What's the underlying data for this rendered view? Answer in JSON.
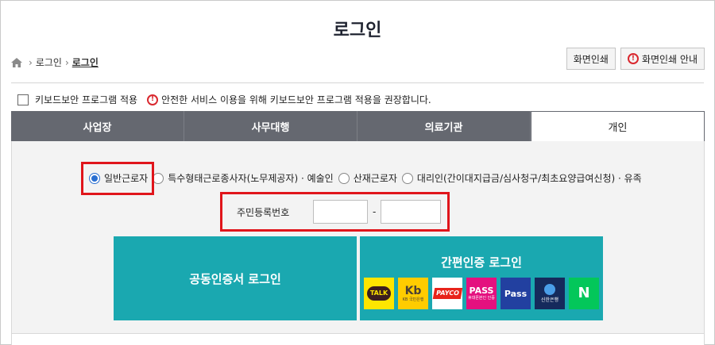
{
  "page_title": "로그인",
  "breadcrumb": {
    "items": [
      "로그인",
      "로그인"
    ]
  },
  "buttons": {
    "print": "화면인쇄",
    "print_guide": "화면인쇄 안내"
  },
  "keyboard_security": {
    "label": "키보드보안 프로그램 적용",
    "notice": "안전한 서비스 이용을 위해 키보드보안 프로그램 적용을 권장합니다."
  },
  "tabs": [
    {
      "label": "사업장",
      "active": false
    },
    {
      "label": "사무대행",
      "active": false
    },
    {
      "label": "의료기관",
      "active": false
    },
    {
      "label": "개인",
      "active": true
    }
  ],
  "user_types": [
    {
      "label": "일반근로자",
      "checked": true
    },
    {
      "label": "특수형태근로종사자(노무제공자) · 예술인",
      "checked": false
    },
    {
      "label": "산재근로자",
      "checked": false
    },
    {
      "label": "대리인(간이대지급금/심사청구/최초요양급여신청) · 유족",
      "checked": false
    }
  ],
  "rrn": {
    "label": "주민등록번호",
    "separator": "-"
  },
  "login_options": {
    "certificate": "공동인증서 로그인",
    "simple": "간편인증 로그인"
  },
  "simple_auth_logos": [
    {
      "name": "kakao",
      "text": "TALK",
      "sub": ""
    },
    {
      "name": "kb",
      "text": "Kb",
      "sub": "KB 국민은행"
    },
    {
      "name": "payco",
      "text": "PAYCO",
      "sub": ""
    },
    {
      "name": "pass1",
      "text": "PASS",
      "sub": "휴대폰본인 인증"
    },
    {
      "name": "pass2",
      "text": "Pass",
      "sub": ""
    },
    {
      "name": "shinhan",
      "text": "",
      "sub": "신한은행"
    },
    {
      "name": "naver",
      "text": "N",
      "sub": ""
    }
  ],
  "colors": {
    "tab_bg": "#656870",
    "teal": "#1aa8b0",
    "highlight": "#e0151b"
  }
}
